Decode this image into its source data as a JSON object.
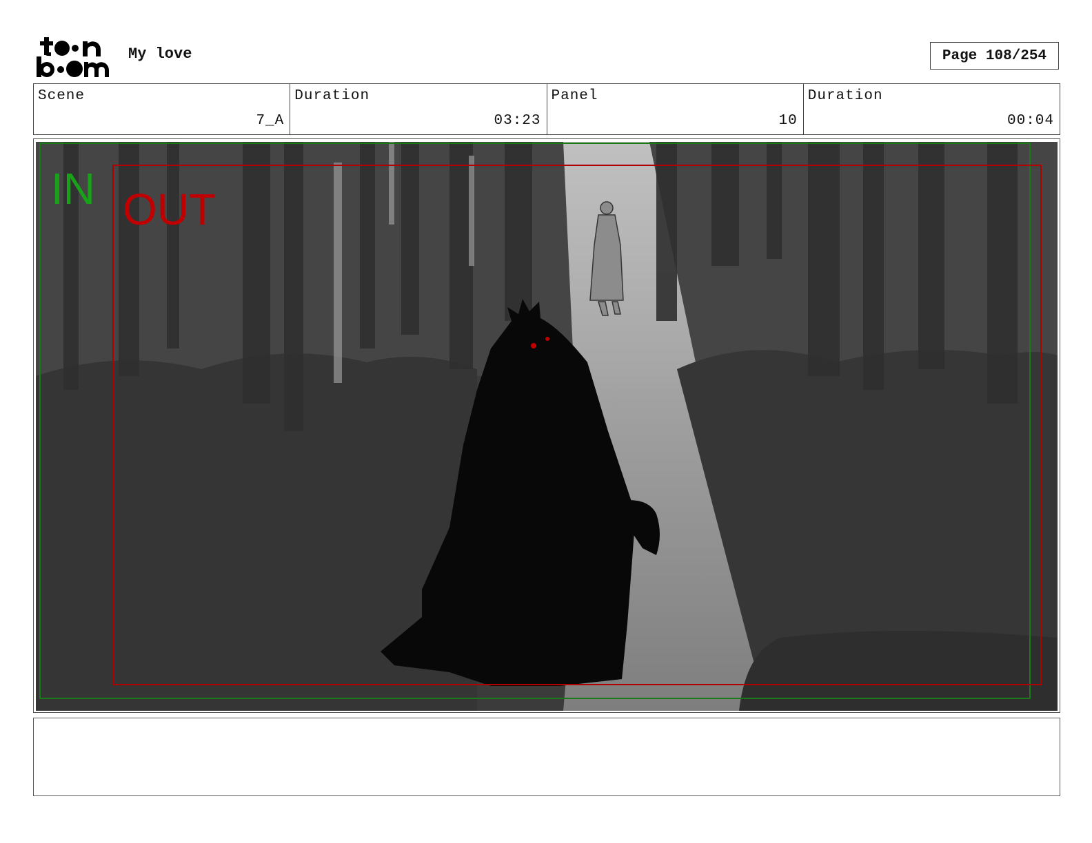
{
  "header": {
    "logo_text": "toon boom",
    "project_title": "My love",
    "page_label": "Page 108/254"
  },
  "info": {
    "scene_label": "Scene",
    "scene_value": "7_A",
    "scene_duration_label": "Duration",
    "scene_duration_value": "03:23",
    "panel_label": "Panel",
    "panel_value": "10",
    "panel_duration_label": "Duration",
    "panel_duration_value": "00:04"
  },
  "panel": {
    "in_marker": "IN",
    "out_marker": "OUT",
    "in_color": "#1aa11a",
    "out_color": "#c00000"
  },
  "notes": {
    "text": ""
  }
}
